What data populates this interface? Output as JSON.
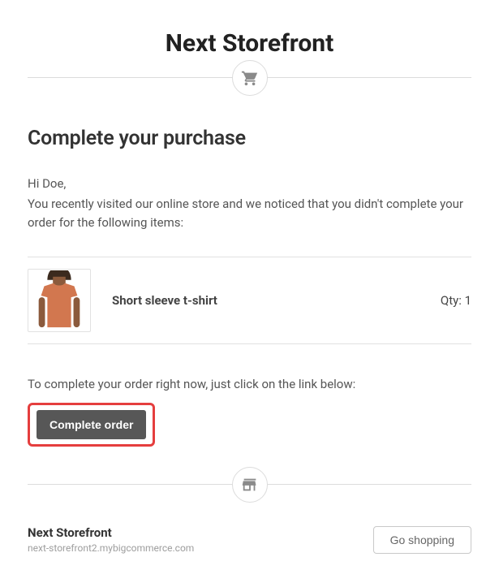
{
  "store": {
    "name": "Next Storefront",
    "domain": "next-storefront2.mybigcommerce.com"
  },
  "heading": "Complete your purchase",
  "greeting": "Hi Doe,",
  "lead": "You recently visited our online store and we noticed that you didn't complete your order for the following items:",
  "item": {
    "name": "Short sleeve t-shirt",
    "qty_label": "Qty: 1"
  },
  "instruction": "To complete your order right now, just click on the link below:",
  "complete_button": "Complete order",
  "go_shopping_button": "Go shopping",
  "icons": {
    "cart": "cart",
    "store": "store"
  },
  "colors": {
    "highlight_border": "#e53e3e",
    "primary_button_bg": "#575757"
  }
}
